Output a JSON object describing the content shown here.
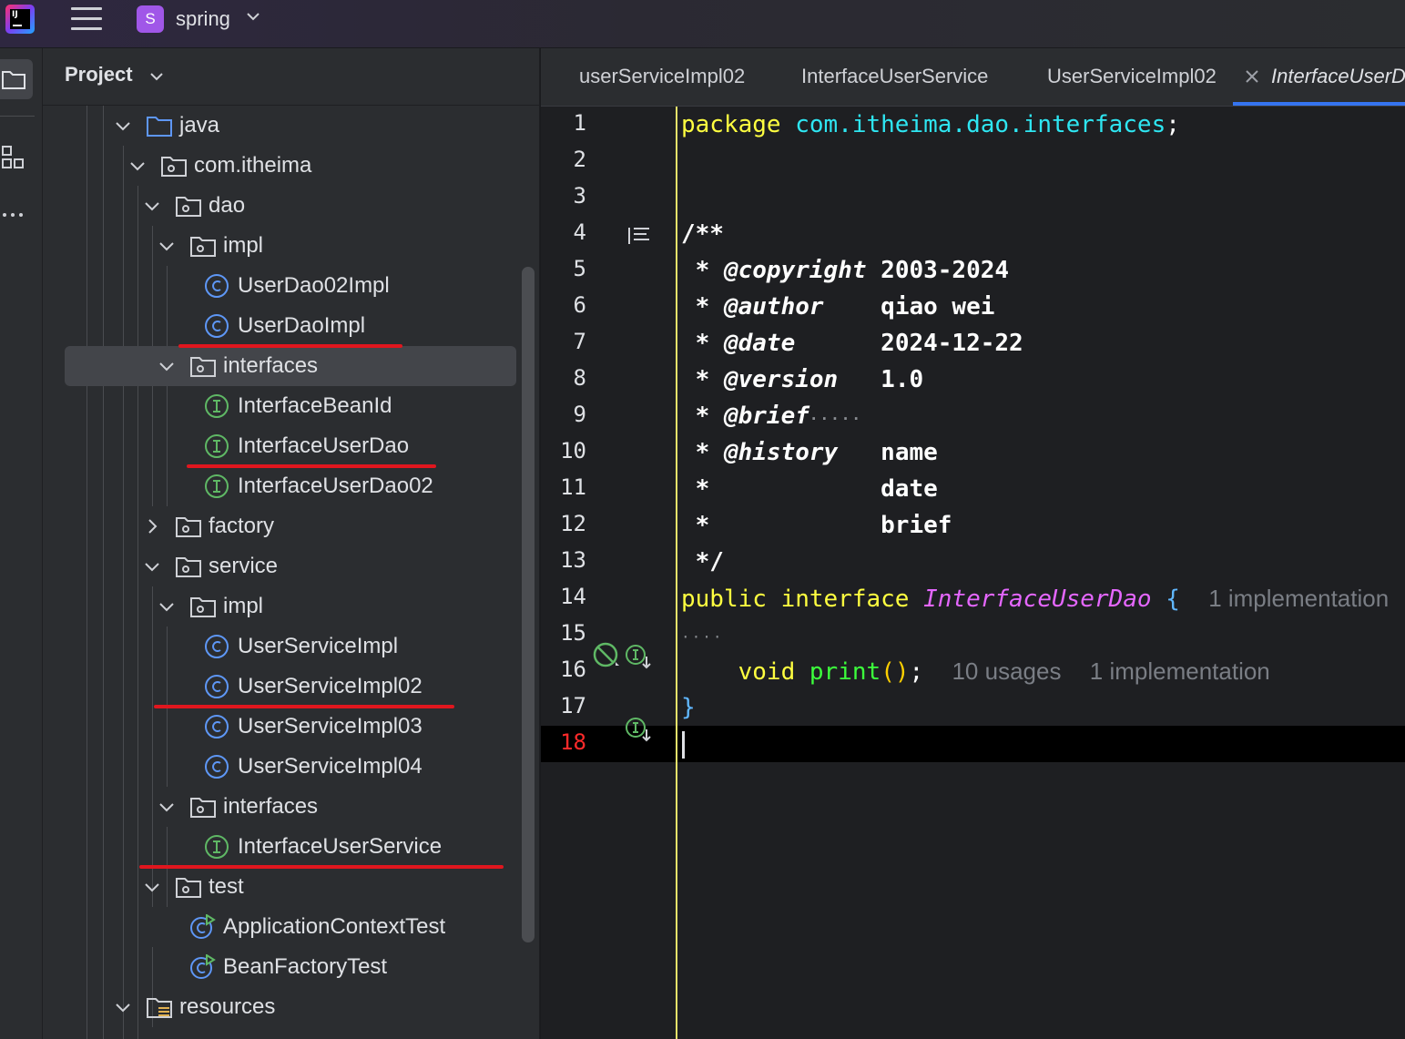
{
  "titlebar": {
    "app_logo_text": "IJ",
    "project_badge": "S",
    "project_name": "spring"
  },
  "panel": {
    "title": "Project"
  },
  "tree": [
    {
      "label": "java",
      "type": "src-folder",
      "expanded": true
    },
    {
      "label": "com.itheima",
      "type": "package",
      "expanded": true
    },
    {
      "label": "dao",
      "type": "package",
      "expanded": true
    },
    {
      "label": "impl",
      "type": "package",
      "expanded": true
    },
    {
      "label": "UserDao02Impl",
      "type": "class"
    },
    {
      "label": "UserDaoImpl",
      "type": "class"
    },
    {
      "label": "interfaces",
      "type": "package",
      "expanded": true,
      "selected": true
    },
    {
      "label": "InterfaceBeanId",
      "type": "interface"
    },
    {
      "label": "InterfaceUserDao",
      "type": "interface"
    },
    {
      "label": "InterfaceUserDao02",
      "type": "interface"
    },
    {
      "label": "factory",
      "type": "package",
      "expanded": false
    },
    {
      "label": "service",
      "type": "package",
      "expanded": true
    },
    {
      "label": "impl",
      "type": "package",
      "expanded": true
    },
    {
      "label": "UserServiceImpl",
      "type": "class"
    },
    {
      "label": "UserServiceImpl02",
      "type": "class"
    },
    {
      "label": "UserServiceImpl03",
      "type": "class"
    },
    {
      "label": "UserServiceImpl04",
      "type": "class"
    },
    {
      "label": "interfaces",
      "type": "package",
      "expanded": true
    },
    {
      "label": "InterfaceUserService",
      "type": "interface"
    },
    {
      "label": "test",
      "type": "package",
      "expanded": true
    },
    {
      "label": "ApplicationContextTest",
      "type": "test-class"
    },
    {
      "label": "BeanFactoryTest",
      "type": "test-class"
    },
    {
      "label": "resources",
      "type": "resources-folder",
      "expanded": true
    }
  ],
  "tabs": [
    {
      "label": "userServiceImpl02"
    },
    {
      "label": "InterfaceUserService"
    },
    {
      "label": "UserServiceImpl02"
    },
    {
      "label": "InterfaceUserDao",
      "active": true
    }
  ],
  "editor": {
    "line_numbers": [
      "1",
      "2",
      "3",
      "4",
      "5",
      "6",
      "7",
      "8",
      "9",
      "10",
      "11",
      "12",
      "13",
      "14",
      "15",
      "16",
      "17",
      "18"
    ],
    "current_line": "18",
    "code": {
      "l1_kw": "package",
      "l1_pkg": "com.itheima.dao.interfaces",
      "l1_semi": ";",
      "l4": "/**",
      "l5_star": " * ",
      "l5_tag": "@copyright",
      "l5_val": " 2003-2024",
      "l6_star": " * ",
      "l6_tag": "@author",
      "l6_val": "    qiao wei",
      "l7_star": " * ",
      "l7_tag": "@date",
      "l7_val": "      2024-12-22",
      "l8_star": " * ",
      "l8_tag": "@version",
      "l8_val": "   1.0",
      "l9_star": " * ",
      "l9_tag": "@brief",
      "l9_dots": "·····",
      "l10_star": " * ",
      "l10_tag": "@history",
      "l10_val": "   name",
      "l11": " *            date",
      "l12": " *            brief",
      "l13": " */",
      "l14_kw": "public interface",
      "l14_name": "InterfaceUserDao",
      "l14_brace": "{",
      "l14_hint": "1 implementation",
      "l15_dots": "····",
      "l16_kw": "void",
      "l16_fn": "print",
      "l16_parens": "()",
      "l16_semi": ";",
      "l16_hint_usages": "10 usages",
      "l16_hint_impl": "1 implementation",
      "l17": "}"
    }
  },
  "colors": {
    "keyword": "#ffff40",
    "package": "#2ee6f2",
    "interface_name": "#e567ff",
    "function": "#3cff3c",
    "annotation_underline": "#e0161e",
    "tab_accent": "#3574f0"
  }
}
